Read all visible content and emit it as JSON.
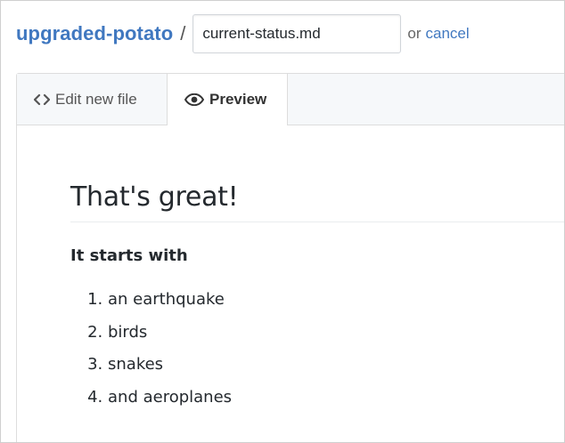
{
  "header": {
    "repo_name": "upgraded-potato",
    "separator": "/",
    "filename_value": "current-status.md",
    "or_text": "or",
    "cancel_label": "cancel"
  },
  "tabs": [
    {
      "label": "Edit new file",
      "icon": "code-icon",
      "active": false
    },
    {
      "label": "Preview",
      "icon": "eye-icon",
      "active": true
    }
  ],
  "preview": {
    "heading": "That's great!",
    "subheading": "It starts with",
    "list_items": [
      "an earthquake",
      "birds",
      "snakes",
      "and aeroplanes"
    ]
  },
  "colors": {
    "link": "#4078c0",
    "text": "#24292e",
    "tabbar_bg": "#f6f8fa",
    "border": "#dddddd"
  }
}
